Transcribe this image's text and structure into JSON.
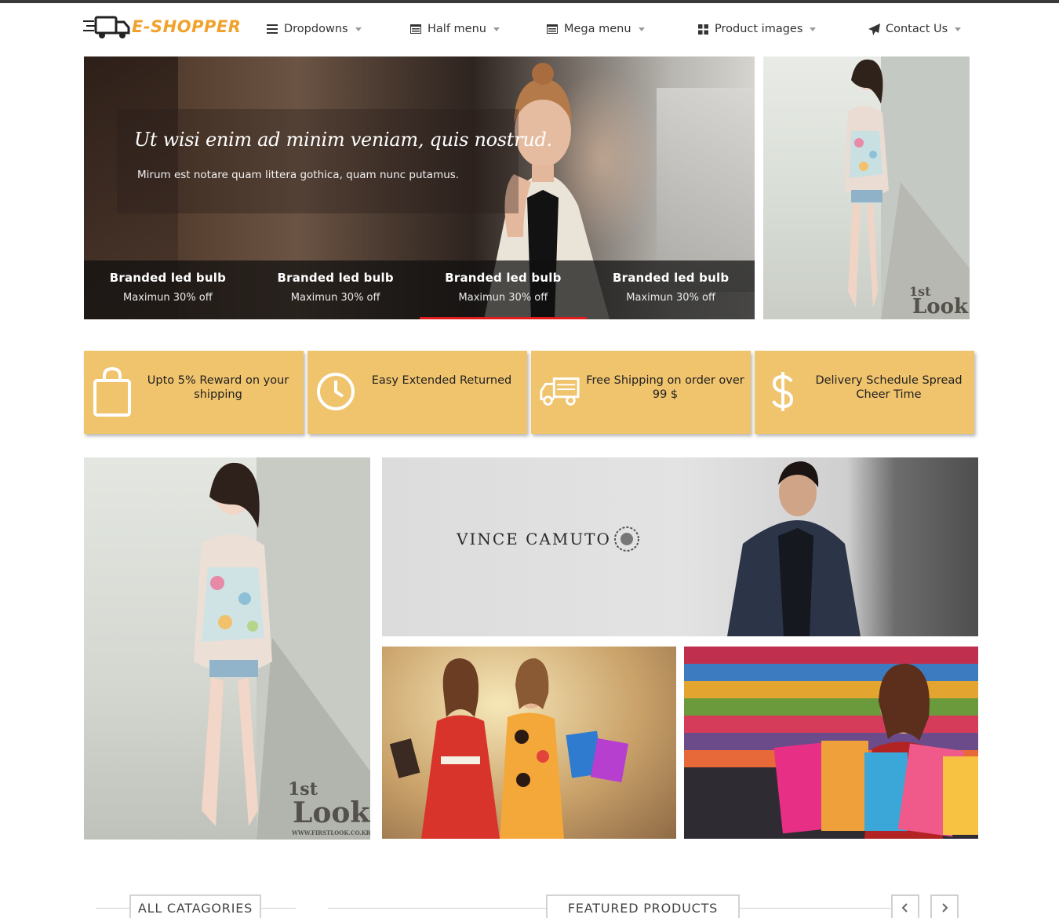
{
  "header": {
    "logo_text": "E-SHOPPER",
    "nav": [
      {
        "label": "Dropdowns",
        "icon": "list-icon"
      },
      {
        "label": "Half menu",
        "icon": "window-list-icon"
      },
      {
        "label": "Mega menu",
        "icon": "window-list-icon"
      },
      {
        "label": "Product images",
        "icon": "grid-icon"
      },
      {
        "label": "Contact Us",
        "icon": "paper-plane-icon"
      }
    ]
  },
  "slider": {
    "heading": "Ut wisi enim ad minim veniam, quis nostrud.",
    "subheading": "Mirum est notare quam littera gothica, quam nunc putamus.",
    "tabs": [
      {
        "title": "Branded led bulb",
        "subtitle": "Maximun 30% off"
      },
      {
        "title": "Branded led bulb",
        "subtitle": "Maximun 30% off"
      },
      {
        "title": "Branded led bulb",
        "subtitle": "Maximun 30% off"
      },
      {
        "title": "Branded led bulb",
        "subtitle": "Maximun 30% off"
      }
    ],
    "active_tab": 3
  },
  "features": [
    {
      "text": "Upto 5% Reward on your shipping",
      "icon": "shopping-bag-icon"
    },
    {
      "text": "Easy Extended Returned",
      "icon": "clock-icon"
    },
    {
      "text": "Free Shipping on order over 99 $",
      "icon": "truck-icon"
    },
    {
      "text": "Delivery Schedule Spread Cheer Time",
      "icon": "dollar-icon"
    }
  ],
  "banners": {
    "brand_text": "VINCE CAMUTO",
    "watermark_top": "1st",
    "watermark_bottom": "Look",
    "watermark_url": "WWW.FIRSTLOOK.CO.KR"
  },
  "sections": {
    "categories": "ALL CATAGORIES",
    "featured": "FEATURED PRODUCTS"
  },
  "colors": {
    "accent": "#f0a22d",
    "feature_bg": "#f0c36d",
    "active_indicator": "#e21b1b"
  }
}
